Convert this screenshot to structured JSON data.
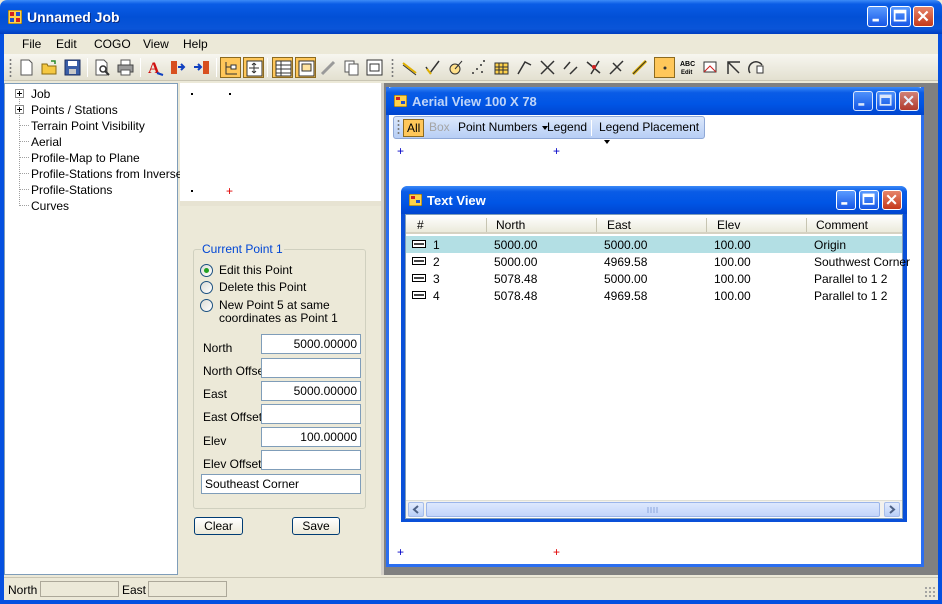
{
  "window": {
    "title": "Unnamed Job"
  },
  "menu": [
    "File",
    "Edit",
    "COGO",
    "View",
    "Help"
  ],
  "tree": {
    "items": [
      {
        "label": "Job",
        "expandable": true
      },
      {
        "label": "Points / Stations",
        "expandable": true
      },
      {
        "label": "Terrain Point Visibility",
        "expandable": false
      },
      {
        "label": "Aerial",
        "expandable": false
      },
      {
        "label": "Profile-Map to Plane",
        "expandable": false
      },
      {
        "label": "Profile-Stations from Inverse",
        "expandable": false
      },
      {
        "label": "Profile-Stations",
        "expandable": false
      },
      {
        "label": "Curves",
        "expandable": false
      }
    ]
  },
  "point_panel": {
    "group_title": "Current Point 1",
    "radios": [
      {
        "label": "Edit this Point",
        "checked": true
      },
      {
        "label": "Delete this Point",
        "checked": false
      },
      {
        "label_line1": "New Point 5 at same",
        "label_line2": "coordinates as Point 1",
        "checked": false
      }
    ],
    "fields": {
      "north_label": "North",
      "north_value": "5000.00000",
      "north_offset_label": "North Offset",
      "north_offset_value": "",
      "east_label": "East",
      "east_value": "5000.00000",
      "east_offset_label": "East Offset",
      "east_offset_value": "",
      "elev_label": "Elev",
      "elev_value": "100.00000",
      "elev_offset_label": "Elev Offset",
      "elev_offset_value": "",
      "comment_value": "Southeast Corner"
    },
    "clear_label": "Clear",
    "save_label": "Save"
  },
  "aerial": {
    "title": "Aerial View   100  X  78",
    "toolbar": {
      "all": "All",
      "box": "Box",
      "point_numbers": "Point Numbers",
      "legend": "Legend",
      "legend_placement": "Legend Placement"
    }
  },
  "textview": {
    "title": "Text View",
    "columns": [
      "#",
      "North",
      "East",
      "Elev",
      "Comment"
    ],
    "rows": [
      {
        "num": "1",
        "north": "5000.00",
        "east": "5000.00",
        "elev": "100.00",
        "comment": "Origin",
        "selected": true
      },
      {
        "num": "2",
        "north": "5000.00",
        "east": "4969.58",
        "elev": "100.00",
        "comment": "Southwest Corner",
        "selected": false
      },
      {
        "num": "3",
        "north": "5078.48",
        "east": "5000.00",
        "elev": "100.00",
        "comment": "Parallel to  1  2",
        "selected": false
      },
      {
        "num": "4",
        "north": "5078.48",
        "east": "4969.58",
        "elev": "100.00",
        "comment": "Parallel to  1  2",
        "selected": false
      }
    ]
  },
  "statusbar": {
    "north_label": "North",
    "north_value": "",
    "east_label": "East",
    "east_value": ""
  },
  "colors": {
    "title_blue": "#0250d6",
    "selection_teal": "#b3dfe4",
    "toolbar_active": "#ffc75a",
    "marker_red": "#e00000",
    "marker_blue": "#0000c8"
  },
  "icons": {
    "toolbar": [
      "new-icon",
      "open-icon",
      "save-icon",
      "print-preview-icon",
      "print-icon",
      "text-style-icon",
      "import-icon",
      "export-icon",
      "tree-view-icon",
      "aerial-view-icon",
      "grid-view-icon",
      "points-view-icon",
      "edit-icon",
      "copy-icon",
      "paste-icon",
      "line-icon",
      "check-line-icon",
      "circle-point-icon",
      "scatter-icon",
      "table-icon",
      "angle-icon",
      "cross-icon",
      "diagonal-icon",
      "intersect-icon",
      "offset-icon",
      "measure-icon",
      "point-box-icon",
      "abc-edit-icon",
      "map-edit-icon",
      "bearing-icon",
      "arc-icon"
    ]
  }
}
